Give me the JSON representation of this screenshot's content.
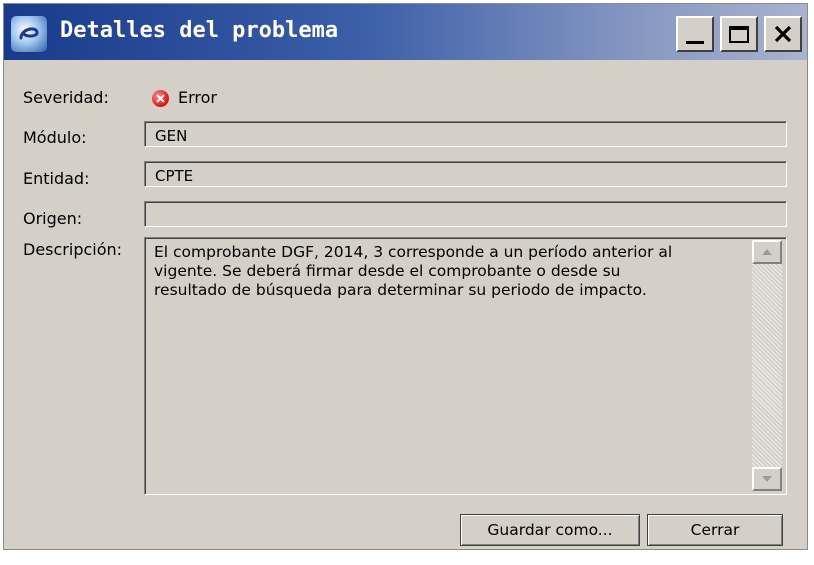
{
  "window": {
    "title": "Detalles del problema",
    "controls": {
      "minimize": "minimize-icon",
      "maximize": "maximize-icon",
      "close": "close-icon"
    }
  },
  "form": {
    "severity_label": "Severidad:",
    "severity_value": "Error",
    "severity_icon": "error-icon",
    "module_label": "Módulo:",
    "module_value": "GEN",
    "entity_label": "Entidad:",
    "entity_value": "CPTE",
    "origin_label": "Origen:",
    "origin_value": "",
    "description_label": "Descripción:",
    "description_lines": [
      "El comprobante DGF, 2014, 3 corresponde a un período anterior al",
      "vigente. Se deberá firmar desde el comprobante o desde su",
      "resultado de búsqueda para determinar su periodo de impacto."
    ]
  },
  "buttons": {
    "save_as": "Guardar como...",
    "close": "Cerrar"
  },
  "colors": {
    "titlebar_start": "#1a3a8c",
    "titlebar_end": "#a9b3cf",
    "dialog_bg": "#d4d0c8",
    "error_red": "#e02020"
  }
}
